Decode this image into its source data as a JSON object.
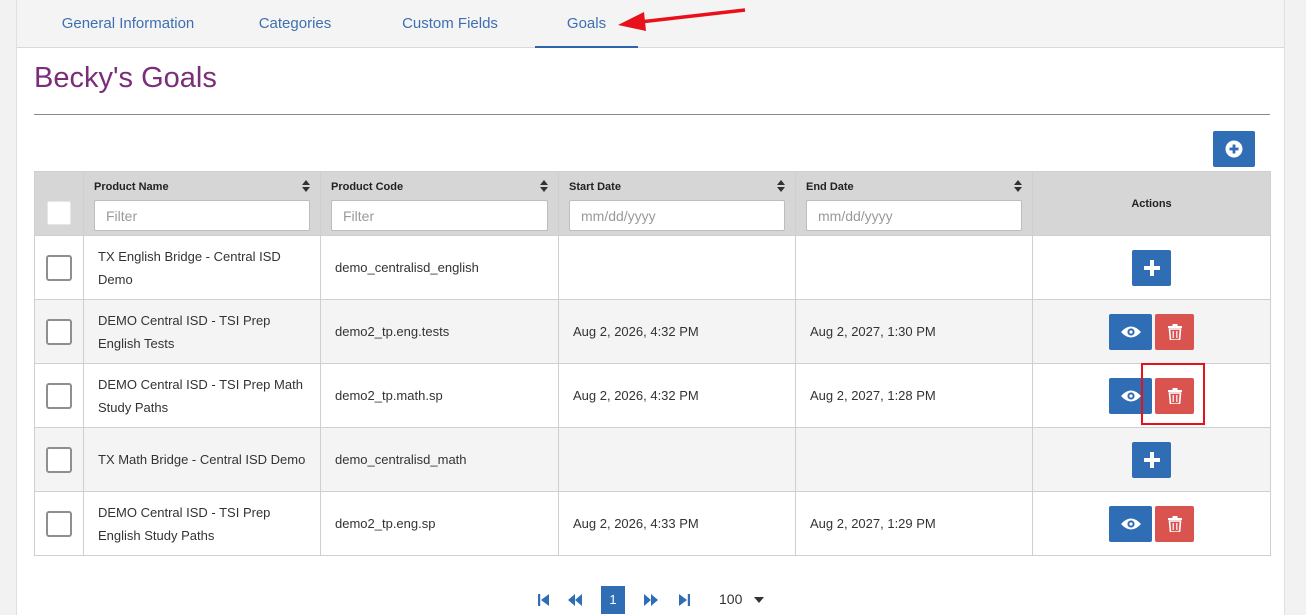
{
  "tabs": [
    {
      "label": "General Information"
    },
    {
      "label": "Categories"
    },
    {
      "label": "Custom Fields"
    },
    {
      "label": "Goals"
    }
  ],
  "active_tab": "Goals",
  "page_title": "Becky's Goals",
  "table": {
    "columns": [
      {
        "label": "Product Name",
        "filter_placeholder": "Filter"
      },
      {
        "label": "Product Code",
        "filter_placeholder": "Filter"
      },
      {
        "label": "Start Date",
        "filter_placeholder": "mm/dd/yyyy"
      },
      {
        "label": "End Date",
        "filter_placeholder": "mm/dd/yyyy"
      },
      {
        "label": "Actions"
      }
    ],
    "rows": [
      {
        "product_name": "TX English Bridge - Central ISD Demo",
        "product_code": "demo_centralisd_english",
        "start_date": "",
        "end_date": "",
        "actions": [
          "add"
        ]
      },
      {
        "product_name": "DEMO Central ISD - TSI Prep English Tests",
        "product_code": "demo2_tp.eng.tests",
        "start_date": "Aug 2, 2026, 4:32 PM",
        "end_date": "Aug 2, 2027, 1:30 PM",
        "actions": [
          "view",
          "delete"
        ]
      },
      {
        "product_name": "DEMO Central ISD - TSI Prep Math Study Paths",
        "product_code": "demo2_tp.math.sp",
        "start_date": "Aug 2, 2026, 4:32 PM",
        "end_date": "Aug 2, 2027, 1:28 PM",
        "actions": [
          "view",
          "delete"
        ]
      },
      {
        "product_name": "TX Math Bridge - Central ISD Demo",
        "product_code": "demo_centralisd_math",
        "start_date": "",
        "end_date": "",
        "actions": [
          "add"
        ]
      },
      {
        "product_name": "DEMO Central ISD - TSI Prep English Study Paths",
        "product_code": "demo2_tp.eng.sp",
        "start_date": "Aug 2, 2026, 4:33 PM",
        "end_date": "Aug 2, 2027, 1:29 PM",
        "actions": [
          "view",
          "delete"
        ]
      }
    ]
  },
  "pagination": {
    "current_page": "1",
    "page_size": "100"
  },
  "icons": {
    "add_goal": "plus-circle-icon",
    "add": "plus-icon",
    "view": "eye-icon",
    "delete": "trash-icon",
    "sort": "sort-icon",
    "first": "first-page-icon",
    "prev": "prev-page-icon",
    "next": "next-page-icon",
    "last": "last-page-icon"
  },
  "colors": {
    "primary": "#2f6db5",
    "danger": "#d9534f",
    "title": "#7a2d78",
    "annotation": "#e8101a"
  }
}
